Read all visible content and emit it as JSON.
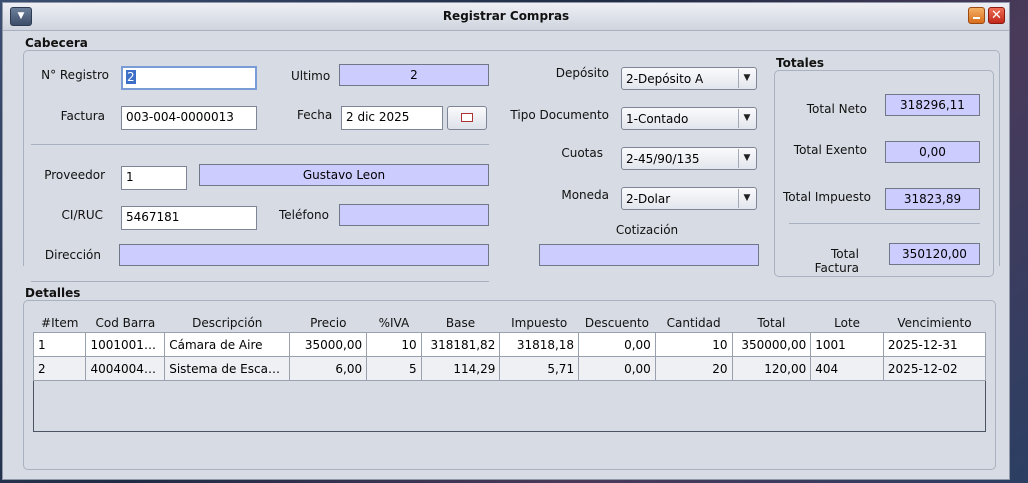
{
  "window": {
    "title": "Registrar Compras"
  },
  "cabecera": {
    "title": "Cabecera",
    "nro_registro_label": "N° Registro",
    "nro_registro_value": "2",
    "ultimo_label": "Ultimo",
    "ultimo_value": "2",
    "factura_label": "Factura",
    "factura_value": "003-004-0000013",
    "fecha_label": "Fecha",
    "fecha_value": "2 dic 2025",
    "proveedor_label": "Proveedor",
    "proveedor_id": "1",
    "proveedor_nombre": "Gustavo Leon",
    "ciruc_label": "CI/RUC",
    "ciruc_value": "5467181",
    "telefono_label": "Teléfono",
    "telefono_value": "",
    "direccion_label": "Dirección",
    "direccion_value": "",
    "deposito_label": "Depósito",
    "deposito_value": "2-Depósito A",
    "tipo_doc_label": "Tipo Documento",
    "tipo_doc_value": "1-Contado",
    "cuotas_label": "Cuotas",
    "cuotas_value": "2-45/90/135",
    "moneda_label": "Moneda",
    "moneda_value": "2-Dolar",
    "cotizacion_label": "Cotización",
    "cotizacion_value": ""
  },
  "totales": {
    "title": "Totales",
    "neto_label": "Total Neto",
    "neto_value": "318296,11",
    "exento_label": "Total Exento",
    "exento_value": "0,00",
    "impuesto_label": "Total Impuesto",
    "impuesto_value": "31823,89",
    "factura_label": "Total Factura",
    "factura_value": "350120,00"
  },
  "detalles": {
    "title": "Detalles",
    "columns": [
      "#Item",
      "Cod Barra",
      "Descripción",
      "Precio",
      "%IVA",
      "Base",
      "Impuesto",
      "Descuento",
      "Cantidad",
      "Total",
      "Lote",
      "Vencimiento"
    ],
    "rows": [
      [
        "1",
        "10010010...",
        "Cámara de Aire",
        "35000,00",
        "10",
        "318181,82",
        "31818,18",
        "0,00",
        "10",
        "350000,00",
        "1001",
        "2025-12-31"
      ],
      [
        "2",
        "40040040...",
        "Sistema de Escap...",
        "6,00",
        "5",
        "114,29",
        "5,71",
        "0,00",
        "20",
        "120,00",
        "404",
        "2025-12-02"
      ]
    ]
  },
  "icons": {
    "system_menu": "chevron-down-icon",
    "minimize": "minimize-icon",
    "close": "close-icon",
    "calendar": "calendar-icon",
    "combo_arrow": "triangle-down-icon"
  },
  "colors": {
    "readonly_field": "#ccccff",
    "window_bg": "#d7dbe3",
    "selection": "#3d6fc6"
  }
}
